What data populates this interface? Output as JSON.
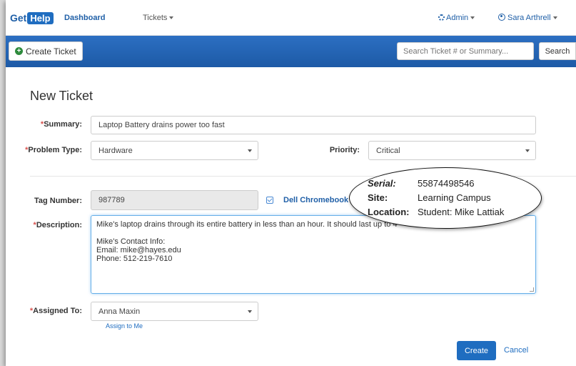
{
  "nav": {
    "logo_get": "Get",
    "logo_help": "Help",
    "dashboard": "Dashboard",
    "tickets": "Tickets",
    "admin": "Admin",
    "user": "Sara Arthrell"
  },
  "toolbar": {
    "create_ticket": "Create Ticket",
    "search_placeholder": "Search Ticket # or Summary...",
    "search_button": "Search"
  },
  "form": {
    "title": "New Ticket",
    "summary_label": "Summary:",
    "summary_value": "Laptop Battery drains power too fast",
    "problem_type_label": "Problem Type:",
    "problem_type_value": "Hardware",
    "priority_label": "Priority:",
    "priority_value": "Critical",
    "tag_label": "Tag Number:",
    "tag_value": "987789",
    "device_link": "Dell Chromebook",
    "description_label": "Description:",
    "description_lines": [
      "Mike's laptop drains through its entire battery in less than an hour.  It should last up to 4",
      "",
      "Mike's Contact Info:",
      "Email: mike@hayes.edu",
      "Phone: 512-219-7610"
    ],
    "assigned_label": "Assigned To:",
    "assigned_value": "Anna Maxin",
    "assign_to_me": "Assign to Me",
    "required_mark": "*",
    "create_button": "Create",
    "cancel_link": "Cancel"
  },
  "callout": {
    "serial_label": "Serial:",
    "serial_value": "55874498546",
    "site_label": "Site:",
    "site_value": "Learning Campus",
    "location_label": "Location:",
    "location_value": "Student: Mike Lattiak"
  },
  "colors": {
    "brand": "#1f6dc0",
    "required": "#d9534f",
    "bar": "#1d5aa6"
  }
}
